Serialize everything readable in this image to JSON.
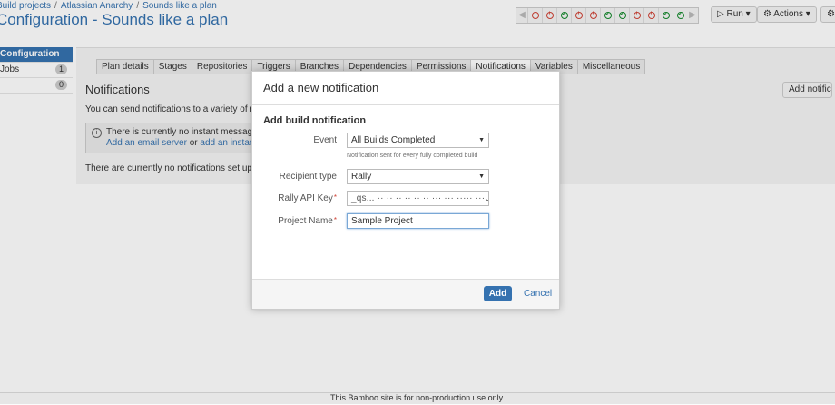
{
  "breadcrumb": [
    "Build projects",
    "Atlassian Anarchy",
    "Sounds like a plan"
  ],
  "page_title": "Configuration - Sounds like a plan",
  "build_statuses": [
    "failed",
    "failed",
    "success",
    "failed",
    "failed",
    "success",
    "success",
    "failed",
    "failed",
    "success",
    "success"
  ],
  "header_buttons": {
    "run": "Run",
    "actions": "Actions"
  },
  "sidebar": {
    "items": [
      {
        "label": "Configuration",
        "count": ""
      },
      {
        "label": "Jobs",
        "count": "1"
      },
      {
        "label": "",
        "count": "0"
      }
    ]
  },
  "tabs": [
    "Plan details",
    "Stages",
    "Repositories",
    "Triggers",
    "Branches",
    "Dependencies",
    "Permissions",
    "Notifications",
    "Variables",
    "Miscellaneous"
  ],
  "active_tab": "Notifications",
  "main": {
    "section_title": "Notifications",
    "add_button": "Add notification",
    "intro": "You can send notifications to a variety of recipients",
    "info_line1": "There is currently no instant messaging",
    "info_link1": "Add an email server",
    "info_or": "or",
    "info_link2": "add an instant messaging server",
    "no_notifications": "There are currently no notifications set up for this plan."
  },
  "dialog": {
    "title": "Add a new notification",
    "heading": "Add build notification",
    "event_label": "Event",
    "event_value": "All Builds Completed",
    "event_hint": "Notification sent for every fully completed build",
    "recipient_label": "Recipient type",
    "recipient_value": "Rally",
    "api_key_label": "Rally API Key",
    "api_key_value": "_qs... ·· ·· ·· ·· ·· ·· ··· ··· ····· ···U",
    "project_label": "Project Name",
    "project_value": "Sample Project",
    "add_button": "Add",
    "cancel_button": "Cancel"
  },
  "footer": "This Bamboo site is for non-production use only."
}
